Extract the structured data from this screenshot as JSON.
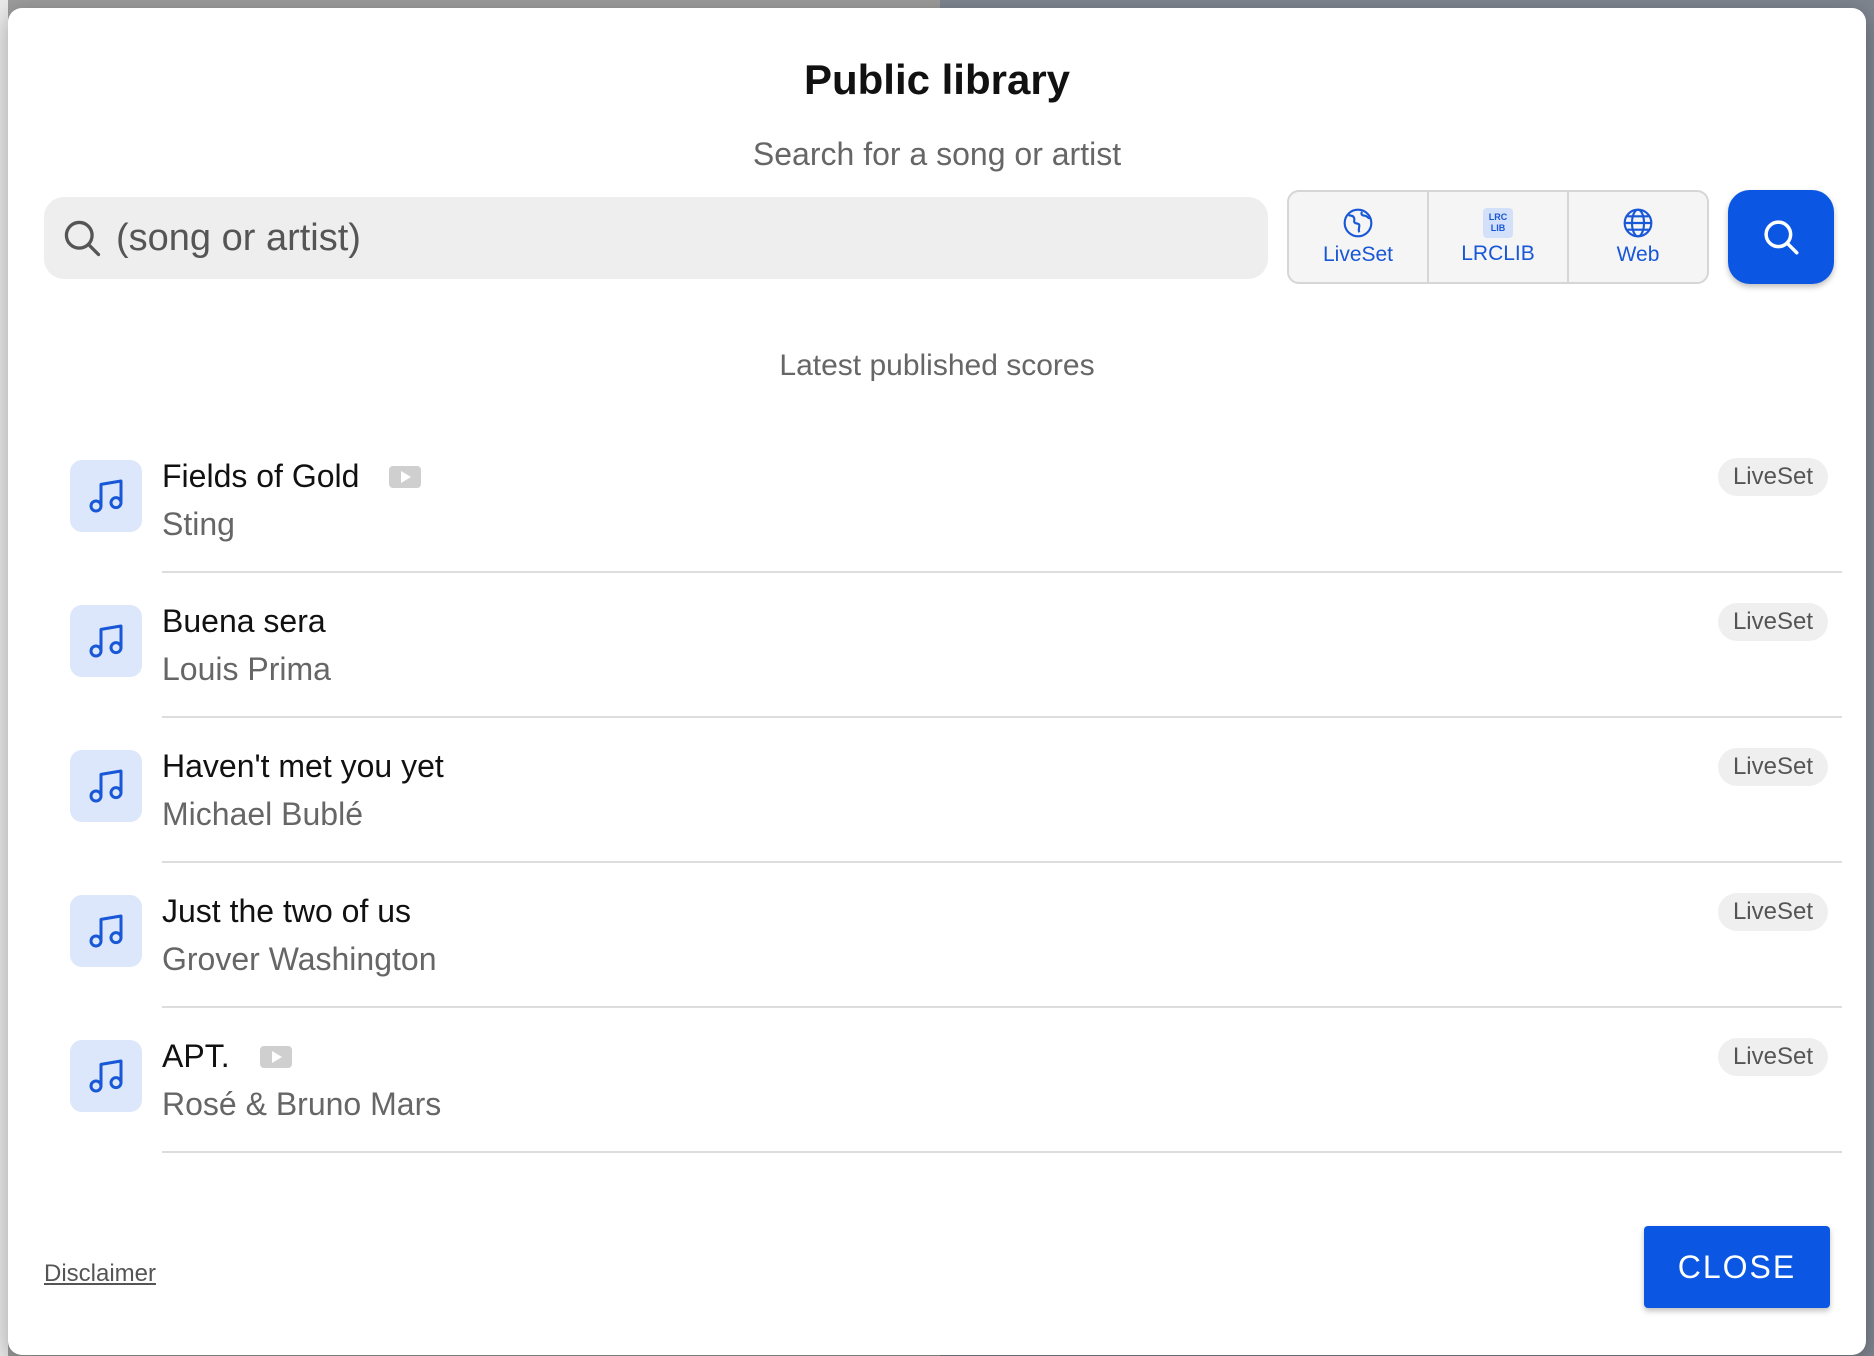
{
  "dialog": {
    "title": "Public library",
    "subtitle": "Search for a song or artist",
    "search": {
      "placeholder": "(song or artist)",
      "value": ""
    },
    "sources": [
      {
        "label": "LiveSet",
        "icon": "globe-americas-icon"
      },
      {
        "label": "LRCLIB",
        "icon": "lrclib-icon",
        "badge_line1": "LRC",
        "badge_line2": "LIB"
      },
      {
        "label": "Web",
        "icon": "globe-icon"
      }
    ],
    "section_heading": "Latest published scores",
    "items": [
      {
        "title": "Fields of Gold",
        "artist": "Sting",
        "source": "LiveSet",
        "has_video": true
      },
      {
        "title": "Buena sera",
        "artist": "Louis Prima",
        "source": "LiveSet",
        "has_video": false
      },
      {
        "title": "Haven't met you yet",
        "artist": "Michael Bublé",
        "source": "LiveSet",
        "has_video": false
      },
      {
        "title": "Just the two of us",
        "artist": "Grover Washington",
        "source": "LiveSet",
        "has_video": false
      },
      {
        "title": "APT.",
        "artist": "Rosé & Bruno Mars",
        "source": "LiveSet",
        "has_video": true
      }
    ],
    "footer": {
      "disclaimer": "Disclaimer",
      "close_label": "CLOSE"
    }
  },
  "colors": {
    "accent": "#0b57e3",
    "icon_blue": "#1857d6",
    "tile_bg": "#dce7fb"
  }
}
